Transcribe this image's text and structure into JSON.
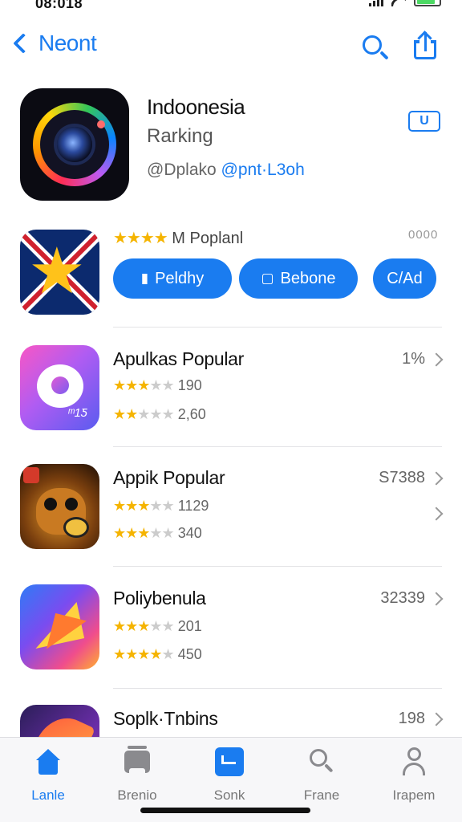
{
  "status_bar": {
    "time": "08:018"
  },
  "nav": {
    "back_label": "Neont"
  },
  "featured": {
    "title": "Indoonesia",
    "subtitle": "Rarking",
    "meta_prefix": "@Dplako",
    "meta_link": "@pnt·L3oh",
    "chip_label": "U"
  },
  "promo": {
    "stars": "★★★★",
    "title": " M Poplanl",
    "more": "0000",
    "buttons": [
      {
        "icon": "▮",
        "label": "Peldhy"
      },
      {
        "icon": "▢",
        "label": "Bebone"
      },
      {
        "icon": "",
        "label": "C/Ad"
      }
    ]
  },
  "apps": [
    {
      "name": "Apulkas Popular",
      "right": "1%",
      "ratings": [
        {
          "filled": "★★★",
          "empty": "★★",
          "value": "190"
        },
        {
          "filled": "★★",
          "empty": "★★★",
          "value": "2,60"
        }
      ]
    },
    {
      "name": "Appik Popular",
      "right": "S7388",
      "ratings": [
        {
          "filled": "★★★",
          "empty": "★★",
          "value": "1129"
        },
        {
          "filled": "★★★",
          "empty": "★★",
          "value": "340"
        }
      ]
    },
    {
      "name": "Poliybenula",
      "right": "32339",
      "ratings": [
        {
          "filled": "★★★",
          "empty": "★★",
          "value": "201"
        },
        {
          "filled": "★★★★",
          "empty": "★",
          "value": "450"
        }
      ]
    },
    {
      "name": "Soplk·Tnbins",
      "right": "198"
    }
  ],
  "tabs": [
    {
      "label": "Lanle"
    },
    {
      "label": "Brenio"
    },
    {
      "label": "Sonk"
    },
    {
      "label": "Frane"
    },
    {
      "label": "Irapem"
    }
  ],
  "colors": {
    "accent": "#1a7cf0",
    "star": "#f5b400"
  }
}
